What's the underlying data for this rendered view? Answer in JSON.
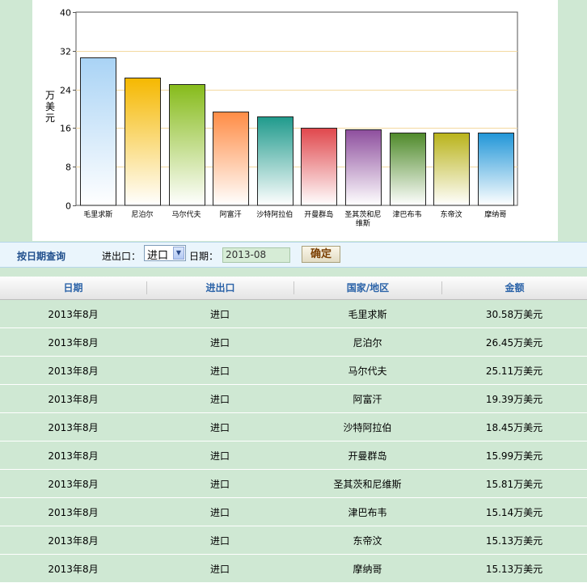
{
  "chart_data": {
    "type": "bar",
    "ylabel": "万美元",
    "ylim": [
      0,
      40
    ],
    "yticks": [
      0,
      8,
      16,
      24,
      32,
      40
    ],
    "categories": [
      "毛里求斯",
      "尼泊尔",
      "马尔代夫",
      "阿富汗",
      "沙特阿拉伯",
      "开曼群岛",
      "圣其茨和尼维斯",
      "津巴布韦",
      "东帝汶",
      "摩纳哥"
    ],
    "category_label_lines": [
      [
        "毛里求斯"
      ],
      [
        "尼泊尔"
      ],
      [
        "马尔代夫"
      ],
      [
        "阿富汗"
      ],
      [
        "沙特阿拉伯"
      ],
      [
        "开曼群岛"
      ],
      [
        "圣其茨和尼",
        "维斯"
      ],
      [
        "津巴布韦"
      ],
      [
        "东帝汶"
      ],
      [
        "摩纳哥"
      ]
    ],
    "values": [
      30.58,
      26.45,
      25.11,
      19.39,
      18.45,
      15.99,
      15.81,
      15.14,
      15.13,
      15.13
    ],
    "bar_colors": [
      "#a9d3f5",
      "#f5b800",
      "#86bb1a",
      "#ff8c45",
      "#1f9a8c",
      "#e0474c",
      "#8e4f9e",
      "#4f8a2a",
      "#b9b31a",
      "#2196d8"
    ],
    "grid_color": "#f3d9a0"
  },
  "query": {
    "title": "按日期查询",
    "io_label": "进出口：",
    "io_selected": "进口",
    "date_label": "日期：",
    "date_value": "2013-08",
    "confirm_label": "确定"
  },
  "table": {
    "headers": [
      "日期",
      "进出口",
      "国家/地区",
      "金额"
    ],
    "rows": [
      [
        "2013年8月",
        "进口",
        "毛里求斯",
        "30.58万美元"
      ],
      [
        "2013年8月",
        "进口",
        "尼泊尔",
        "26.45万美元"
      ],
      [
        "2013年8月",
        "进口",
        "马尔代夫",
        "25.11万美元"
      ],
      [
        "2013年8月",
        "进口",
        "阿富汗",
        "19.39万美元"
      ],
      [
        "2013年8月",
        "进口",
        "沙特阿拉伯",
        "18.45万美元"
      ],
      [
        "2013年8月",
        "进口",
        "开曼群岛",
        "15.99万美元"
      ],
      [
        "2013年8月",
        "进口",
        "圣其茨和尼维斯",
        "15.81万美元"
      ],
      [
        "2013年8月",
        "进口",
        "津巴布韦",
        "15.14万美元"
      ],
      [
        "2013年8月",
        "进口",
        "东帝汶",
        "15.13万美元"
      ],
      [
        "2013年8月",
        "进口",
        "摩纳哥",
        "15.13万美元"
      ]
    ]
  }
}
